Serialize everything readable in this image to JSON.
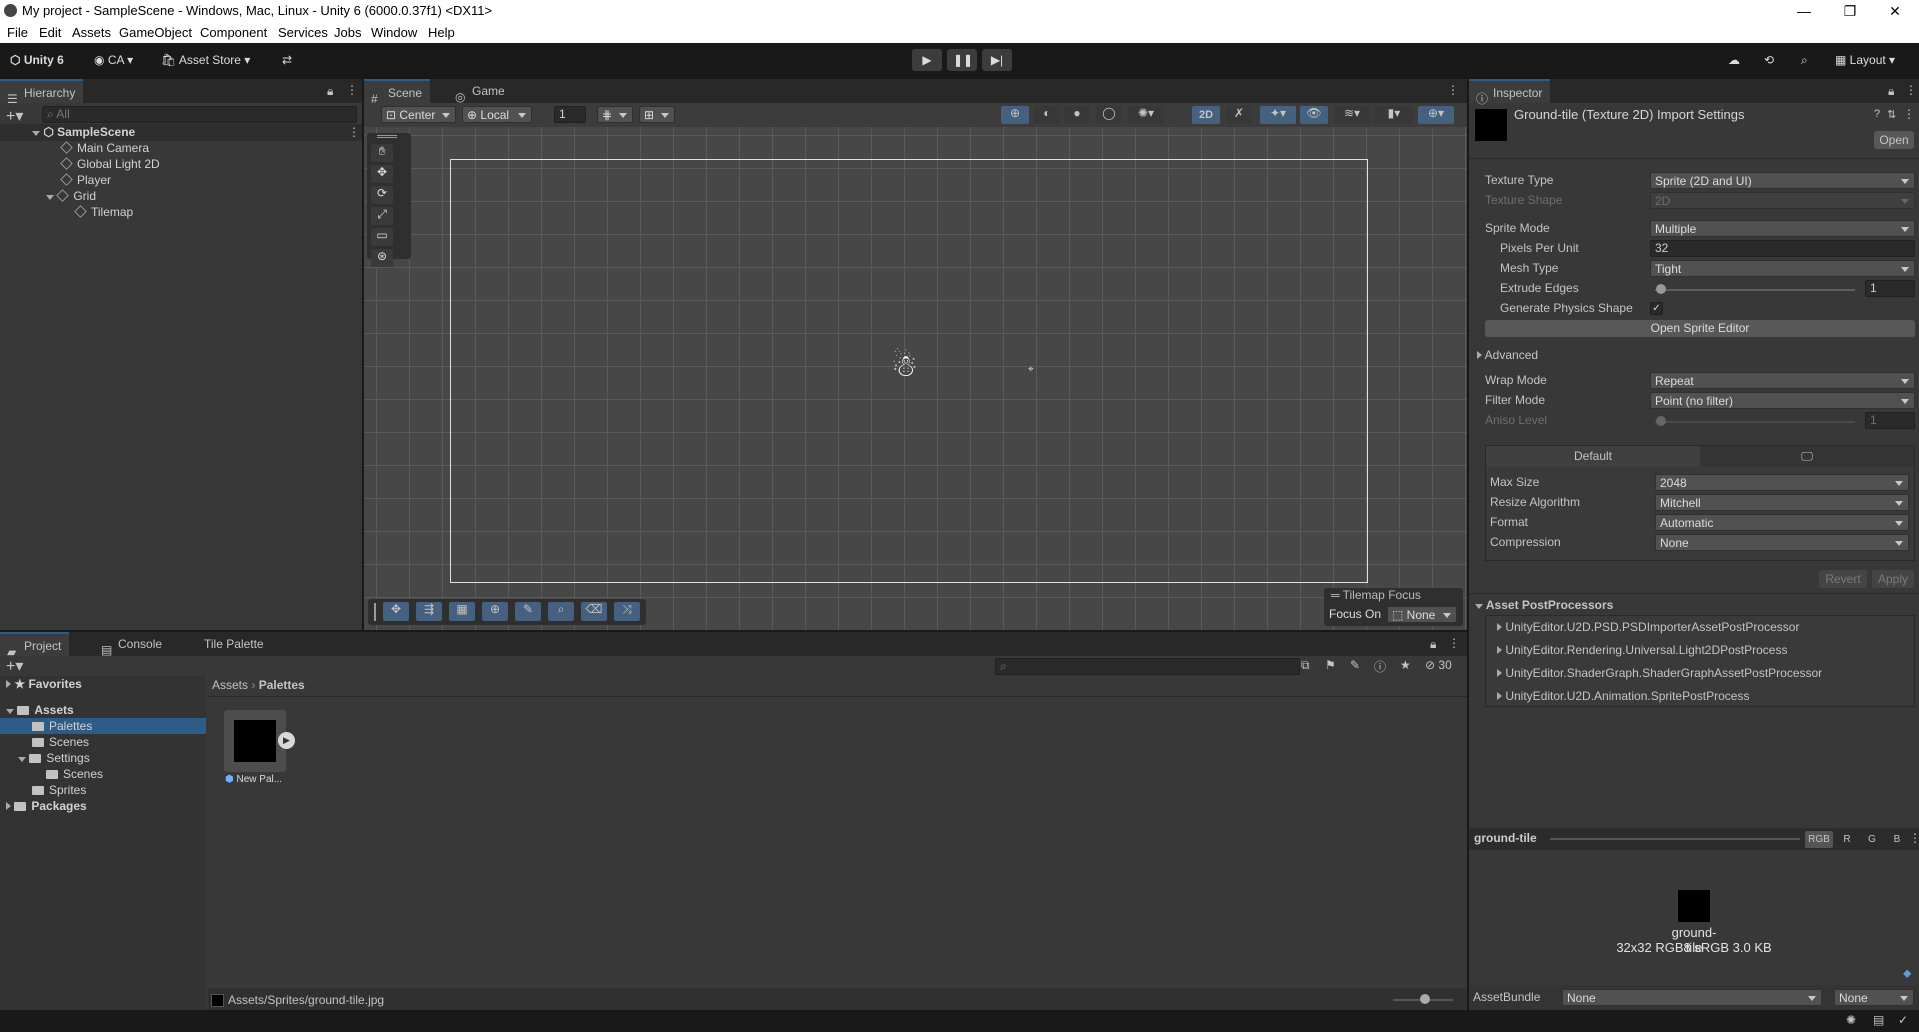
{
  "window": {
    "title": "My project - SampleScene - Windows, Mac, Linux - Unity 6 (6000.0.37f1) <DX11>",
    "minimize": "—",
    "maximize": "❐",
    "close": "✕"
  },
  "menu": [
    "File",
    "Edit",
    "Assets",
    "GameObject",
    "Component",
    "Services",
    "Jobs",
    "Window",
    "Help"
  ],
  "toolbar": {
    "account": "Unity 6",
    "user": "CA",
    "asset_store": "Asset Store",
    "layout": "Layout"
  },
  "hierarchy": {
    "tab": "Hierarchy",
    "search_placeholder": "All",
    "scene": "SampleScene",
    "items": [
      "Main Camera",
      "Global Light 2D",
      "Player",
      "Grid",
      "Tilemap"
    ]
  },
  "scene": {
    "tabs": [
      "Scene",
      "Game"
    ],
    "pivot": "Center",
    "space": "Local",
    "grid_size": "1",
    "mode_2d": "2D",
    "tilemap_focus_title": "Tilemap Focus",
    "focus_on_label": "Focus On",
    "focus_on_value": "None"
  },
  "inspector": {
    "tab": "Inspector",
    "title": "Ground-tile (Texture 2D) Import Settings",
    "open_button": "Open",
    "fields": {
      "texture_type": {
        "label": "Texture Type",
        "value": "Sprite (2D and UI)"
      },
      "texture_shape": {
        "label": "Texture Shape",
        "value": "2D"
      },
      "sprite_mode": {
        "label": "Sprite Mode",
        "value": "Multiple"
      },
      "pixels_per_unit": {
        "label": "Pixels Per Unit",
        "value": "32"
      },
      "mesh_type": {
        "label": "Mesh Type",
        "value": "Tight"
      },
      "extrude_edges": {
        "label": "Extrude Edges",
        "value": "1",
        "fraction": 0.03
      },
      "generate_physics": {
        "label": "Generate Physics Shape",
        "value": "✓"
      },
      "open_sprite_editor": "Open Sprite Editor",
      "advanced": "Advanced",
      "wrap_mode": {
        "label": "Wrap Mode",
        "value": "Repeat"
      },
      "filter_mode": {
        "label": "Filter Mode",
        "value": "Point (no filter)"
      },
      "aniso_level": {
        "label": "Aniso Level",
        "value": "1",
        "fraction": 0.03
      }
    },
    "platform": {
      "default_tab": "Default",
      "max_size": {
        "label": "Max Size",
        "value": "2048"
      },
      "resize_algorithm": {
        "label": "Resize Algorithm",
        "value": "Mitchell"
      },
      "format": {
        "label": "Format",
        "value": "Automatic"
      },
      "compression": {
        "label": "Compression",
        "value": "None"
      }
    },
    "revert": "Revert",
    "apply": "Apply",
    "postprocessors": {
      "title": "Asset PostProcessors",
      "items": [
        "UnityEditor.U2D.PSD.PSDImporterAssetPostProcessor",
        "UnityEditor.Rendering.Universal.Light2DPostProcess",
        "UnityEditor.ShaderGraph.ShaderGraphAssetPostProcessor",
        "UnityEditor.U2D.Animation.SpritePostProcess"
      ]
    },
    "preview": {
      "name": "ground-tile",
      "channels": [
        "RGB",
        "R",
        "G",
        "B"
      ],
      "label": "ground-tile",
      "info": "32x32  RGB8 sRGB   3.0 KB"
    },
    "asset_bundle": {
      "label": "AssetBundle",
      "value": "None",
      "variant": "None"
    }
  },
  "project": {
    "tabs": [
      "Project",
      "Console",
      "Tile Palette"
    ],
    "count": "30",
    "tree": {
      "favorites": "Favorites",
      "assets": "Assets",
      "palettes": "Palettes",
      "scenes": "Scenes",
      "settings": "Settings",
      "settings_scenes": "Scenes",
      "sprites": "Sprites",
      "packages": "Packages"
    },
    "breadcrumb": [
      "Assets",
      "Palettes"
    ],
    "asset_name": "New Pal...",
    "status_path": "Assets/Sprites/ground-tile.jpg"
  },
  "colors": {
    "accent": "#2c5d87",
    "selection": "#2c5d87",
    "panel": "#383838",
    "background": "#191919"
  }
}
